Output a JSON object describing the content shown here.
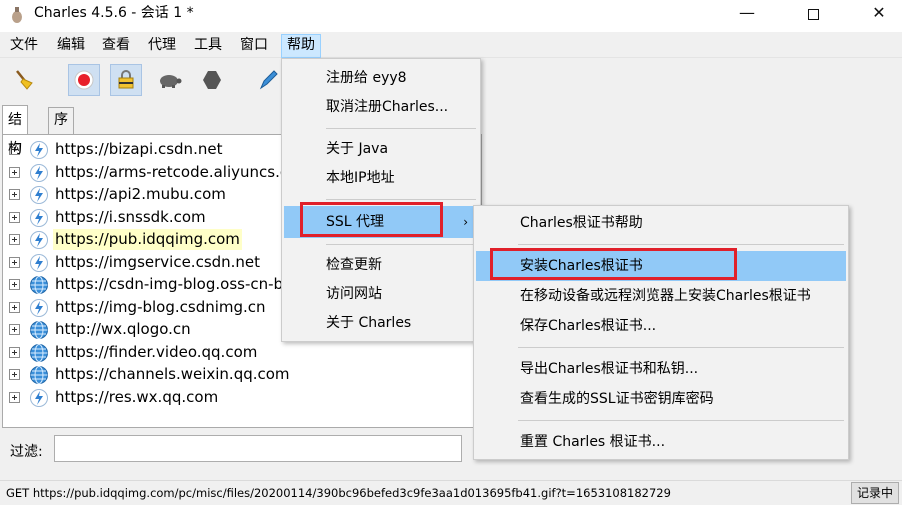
{
  "window": {
    "title": "Charles 4.5.6 - 会话 1 *",
    "minimize": "—",
    "close": "✕"
  },
  "menubar": [
    {
      "label": "文件"
    },
    {
      "label": "编辑"
    },
    {
      "label": "查看"
    },
    {
      "label": "代理"
    },
    {
      "label": "工具"
    },
    {
      "label": "窗口"
    },
    {
      "label": "帮助",
      "active": true
    }
  ],
  "toolbar": [
    {
      "icon": "broom-icon"
    },
    {
      "icon": "record-icon",
      "pressed": true
    },
    {
      "icon": "ssl-lock-icon",
      "pressed": true
    },
    {
      "icon": "turtle-throttle-icon"
    },
    {
      "icon": "breakpoint-hexagon-icon"
    },
    {
      "icon": "pen-compose-icon"
    }
  ],
  "tabs": [
    {
      "label": "结构",
      "selected": true
    },
    {
      "label": "序列"
    }
  ],
  "tree": [
    {
      "host": "https://bizapi.csdn.net",
      "icon": "lightning"
    },
    {
      "host": "https://arms-retcode.aliyuncs.com",
      "icon": "lightning"
    },
    {
      "host": "https://api2.mubu.com",
      "icon": "lightning"
    },
    {
      "host": "https://i.snssdk.com",
      "icon": "lightning"
    },
    {
      "host": "https://pub.idqqimg.com",
      "icon": "lightning",
      "highlight": true
    },
    {
      "host": "https://imgservice.csdn.net",
      "icon": "lightning"
    },
    {
      "host": "https://csdn-img-blog.oss-cn-beijing.aliyuncs.com",
      "icon": "globe"
    },
    {
      "host": "https://img-blog.csdnimg.cn",
      "icon": "lightning"
    },
    {
      "host": "http://wx.qlogo.cn",
      "icon": "globe"
    },
    {
      "host": "https://finder.video.qq.com",
      "icon": "globe"
    },
    {
      "host": "https://channels.weixin.qq.com",
      "icon": "globe"
    },
    {
      "host": "https://res.wx.qq.com",
      "icon": "lightning"
    }
  ],
  "filter": {
    "label": "过滤:",
    "value": ""
  },
  "status": {
    "text": "GET https://pub.idqqimg.com/pc/misc/files/20200114/390bc96befed3c9fe3aa1d013695fb41.gif?t=1653108182729",
    "recording": "记录中"
  },
  "help_menu": [
    {
      "label": "注册给 eyy8"
    },
    {
      "label": "取消注册Charles..."
    },
    {
      "separator": true
    },
    {
      "label": "关于 Java"
    },
    {
      "label": "本地IP地址"
    },
    {
      "separator": true
    },
    {
      "label": "SSL 代理",
      "submenu": true,
      "hover": true,
      "arrow": "›"
    },
    {
      "separator": true
    },
    {
      "label": "检查更新"
    },
    {
      "label": "访问网站"
    },
    {
      "label": "关于 Charles"
    }
  ],
  "ssl_submenu": [
    {
      "label": "Charles根证书帮助"
    },
    {
      "separator": true
    },
    {
      "label": "安装Charles根证书",
      "hover": true
    },
    {
      "label": "在移动设备或远程浏览器上安装Charles根证书"
    },
    {
      "label": "保存Charles根证书..."
    },
    {
      "separator": true
    },
    {
      "label": "导出Charles根证书和私钥..."
    },
    {
      "label": "查看生成的SSL证书密钥库密码"
    },
    {
      "separator": true
    },
    {
      "label": "重置 Charles 根证书..."
    }
  ],
  "colors": {
    "highlight_row": "#ffffc8",
    "menu_hover": "#91c9f7",
    "annotation_red": "#e0202a",
    "active_menu": "#cce8ff"
  }
}
